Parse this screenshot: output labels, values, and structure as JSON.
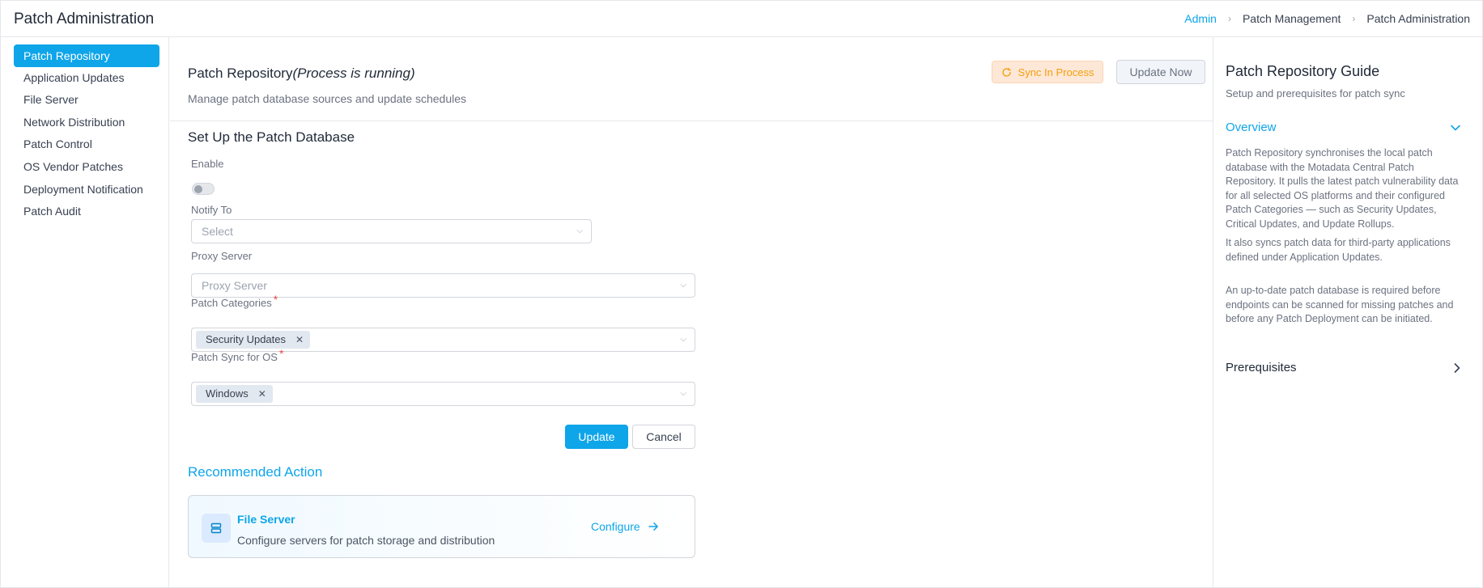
{
  "header": {
    "title": "Patch Administration",
    "breadcrumb": [
      "Admin",
      "Patch Management",
      "Patch Administration"
    ]
  },
  "sidebar": {
    "items": [
      {
        "label": "Patch Repository",
        "active": true
      },
      {
        "label": "Application Updates",
        "active": false
      },
      {
        "label": "File Server",
        "active": false
      },
      {
        "label": "Network Distribution",
        "active": false
      },
      {
        "label": "Patch Control",
        "active": false
      },
      {
        "label": "OS Vendor Patches",
        "active": false
      },
      {
        "label": "Deployment Notification",
        "active": false
      },
      {
        "label": "Patch Audit",
        "active": false
      }
    ]
  },
  "main": {
    "title": "Patch Repository",
    "status": "(Process is running)",
    "subtitle": "Manage patch database sources and update schedules",
    "sync_button": "Sync In Process",
    "update_now_button": "Update Now",
    "section_title": "Set Up the Patch Database",
    "form": {
      "enable_label": "Enable",
      "enable_on": false,
      "notify_label": "Notify To",
      "notify_placeholder": "Select",
      "proxy_label": "Proxy Server",
      "proxy_placeholder": "Proxy Server",
      "categories_label": "Patch Categories",
      "categories_required": "*",
      "categories_tags": [
        "Security Updates"
      ],
      "os_label": "Patch Sync for OS",
      "os_required": "*",
      "os_tags": [
        "Windows"
      ],
      "update_button": "Update",
      "cancel_button": "Cancel"
    },
    "recommended": {
      "title": "Recommended Action",
      "card_title": "File Server",
      "card_desc": "Configure servers for patch storage and distribution",
      "card_action": "Configure"
    }
  },
  "guide": {
    "title": "Patch Repository Guide",
    "subtitle": "Setup and prerequisites for patch sync",
    "overview_label": "Overview",
    "overview_paragraphs": [
      "Patch Repository synchronises the local patch database with the Motadata Central Patch Repository. It pulls the latest patch vulnerability data for all selected OS platforms and their configured Patch Categories — such as Security Updates, Critical Updates, and Update Rollups.",
      "It also syncs patch data for third-party applications defined under Application Updates.",
      "An up-to-date patch database is required before endpoints can be scanned for missing patches and before any Patch Deployment can be initiated."
    ],
    "prerequisites_label": "Prerequisites"
  },
  "colors": {
    "accent": "#0ea5e9",
    "warning_bg": "#fde8d7",
    "warning_text": "#f59e0b",
    "required": "#ef4444"
  }
}
